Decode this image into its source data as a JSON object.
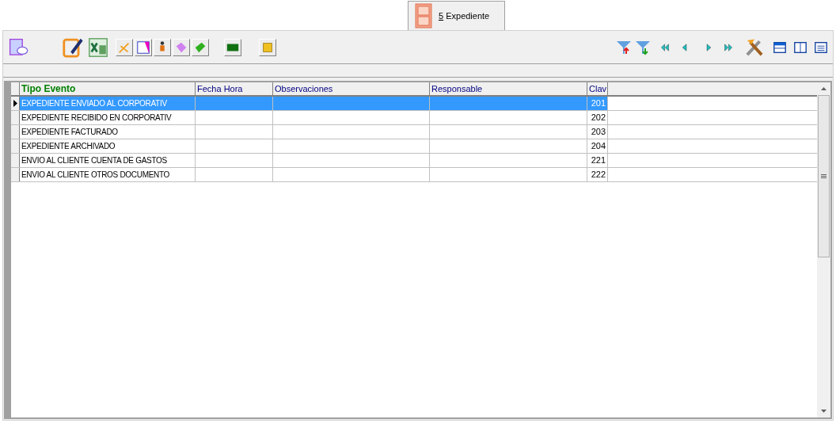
{
  "tab": {
    "label": "5 Expediente",
    "selected": true
  },
  "table": {
    "columns": [
      {
        "label": "Tipo Evento",
        "highlighted": true
      },
      {
        "label": "Fecha Hora",
        "highlighted": false
      },
      {
        "label": "Observaciones",
        "highlighted": false
      },
      {
        "label": "Responsable",
        "highlighted": false
      },
      {
        "label": "Clav",
        "highlighted": false
      }
    ],
    "rows": [
      {
        "selected": true,
        "cells": [
          "EXPEDIENTE ENVIADO AL CORPORATIV",
          "",
          "",
          "",
          "201"
        ]
      },
      {
        "selected": false,
        "cells": [
          "EXPEDIENTE RECIBIDO EN CORPORATIV",
          "",
          "",
          "",
          "202"
        ]
      },
      {
        "selected": false,
        "cells": [
          "EXPEDIENTE FACTURADO",
          "",
          "",
          "",
          "203"
        ]
      },
      {
        "selected": false,
        "cells": [
          "EXPEDIENTE ARCHIVADO",
          "",
          "",
          "",
          "204"
        ]
      },
      {
        "selected": false,
        "cells": [
          "ENVIO AL CLIENTE CUENTA DE GASTOS",
          "",
          "",
          "",
          "221"
        ]
      },
      {
        "selected": false,
        "cells": [
          "ENVIO AL CLIENTE OTROS DOCUMENTO",
          "",
          "",
          "",
          "222"
        ]
      }
    ]
  }
}
